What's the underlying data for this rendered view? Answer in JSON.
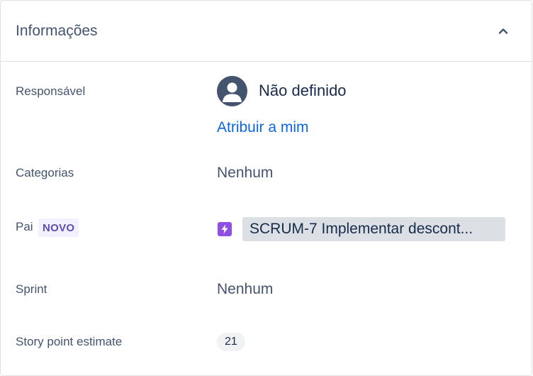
{
  "panel": {
    "title": "Informações",
    "collapse_icon": "chevron-up-icon"
  },
  "fields": {
    "assignee": {
      "label": "Responsável",
      "value": "Não definido",
      "avatar_icon": "user-avatar-icon",
      "assign_link": "Atribuir a mim"
    },
    "categories": {
      "label": "Categorias",
      "value": "Nenhum"
    },
    "parent": {
      "label": "Pai",
      "badge": "NOVO",
      "issue_icon": "epic-icon",
      "value": "SCRUM-7 Implementar descont..."
    },
    "sprint": {
      "label": "Sprint",
      "value": "Nenhum"
    },
    "story_points": {
      "label": "Story point estimate",
      "value": "21"
    }
  },
  "colors": {
    "link": "#0c66e4",
    "epic": "#904ee2",
    "lozenge_bg": "#f3f0ff",
    "lozenge_text": "#5e4db2"
  }
}
